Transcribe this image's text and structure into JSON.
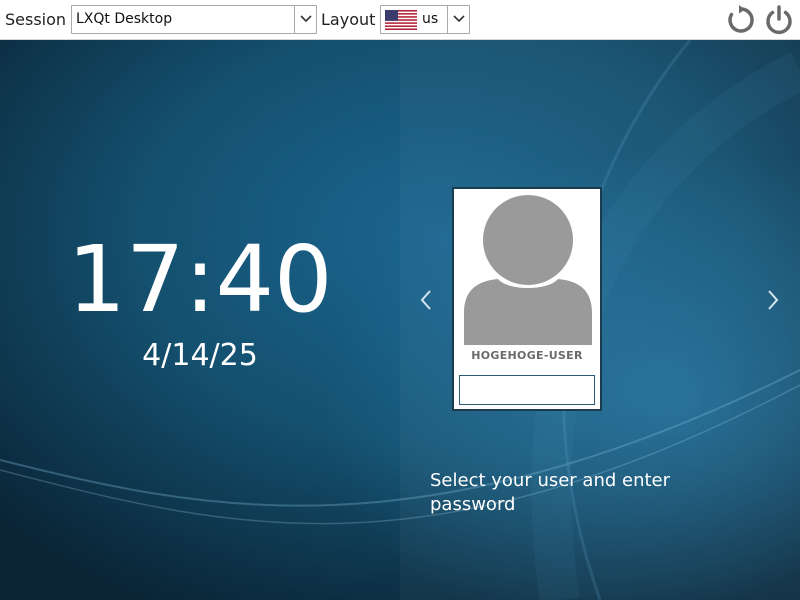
{
  "topbar": {
    "session_label": "Session",
    "session_value": "LXQt Desktop",
    "layout_label": "Layout",
    "layout_value": "us"
  },
  "clock": {
    "time": "17:40",
    "date": "4/14/25"
  },
  "user_card": {
    "username": "HOGEHOGE-USER",
    "password_value": ""
  },
  "hint": "Select your user and enter password",
  "icons": {
    "restart": "restart-icon",
    "power": "power-icon",
    "previous": "chevron-left-icon",
    "next": "chevron-right-icon",
    "flag": "us-flag-icon"
  },
  "colors": {
    "background": "#0d2c40",
    "accent": "#2d5a74"
  }
}
